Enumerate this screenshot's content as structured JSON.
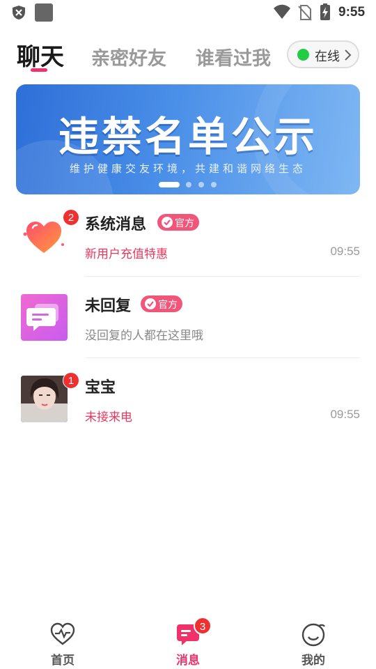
{
  "status_bar": {
    "time": "9:55",
    "icons": [
      "shield-icon",
      "app-icon",
      "wifi-icon",
      "no-sim-icon",
      "battery-charging-icon"
    ]
  },
  "tabs": {
    "chat": "聊天",
    "friends": "亲密好友",
    "visitors": "谁看过我",
    "active": "chat"
  },
  "online_status": {
    "label": "在线",
    "color": "#22cc44"
  },
  "banner": {
    "title": "违禁名单公示",
    "subtitle": "维护健康交友环境，共建和谐网络生态",
    "slide_count": 4,
    "active_slide": 1
  },
  "conversations": [
    {
      "name": "系统消息",
      "official_label": "官方",
      "badge": "2",
      "preview": "新用户充值特惠",
      "time": "09:55",
      "avatar": "heart-icon"
    },
    {
      "name": "未回复",
      "official_label": "官方",
      "preview": "没回复的人都在这里哦",
      "avatar": "chat-bubbles-icon"
    },
    {
      "name": "宝宝",
      "badge": "1",
      "preview": "未接来电",
      "time": "09:55",
      "avatar": "user-photo"
    }
  ],
  "bottom_nav": {
    "home": "首页",
    "messages": "消息",
    "messages_badge": "3",
    "me": "我的",
    "active": "messages"
  },
  "colors": {
    "accent": "#f0326a",
    "badge": "#f03030",
    "official": "#f2557a",
    "banner_blue": "#2e6fd8"
  }
}
